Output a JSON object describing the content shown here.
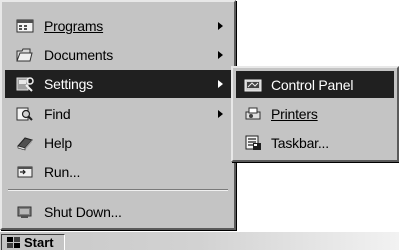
{
  "start_menu": {
    "items": [
      {
        "label": "Programs",
        "icon": "programs-icon",
        "has_submenu": true
      },
      {
        "label": "Documents",
        "icon": "documents-icon",
        "has_submenu": true
      },
      {
        "label": "Settings",
        "icon": "settings-icon",
        "has_submenu": true,
        "selected": true
      },
      {
        "label": "Find",
        "icon": "find-icon",
        "has_submenu": true
      },
      {
        "label": "Help",
        "icon": "help-icon",
        "has_submenu": false
      },
      {
        "label": "Run...",
        "icon": "run-icon",
        "has_submenu": false
      },
      {
        "label": "Shut Down...",
        "icon": "shut-down-icon",
        "has_submenu": false
      }
    ]
  },
  "settings_submenu": {
    "items": [
      {
        "label": "Control Panel",
        "icon": "control-panel-icon",
        "selected": true
      },
      {
        "label": "Printers",
        "icon": "printers-icon"
      },
      {
        "label": "Taskbar...",
        "icon": "taskbar-icon"
      }
    ]
  },
  "taskbar": {
    "start_label": "Start",
    "start_icon": "windows-logo-icon"
  },
  "colors": {
    "menu_background": "#c4c4c4",
    "selection": "#202020",
    "selection_text": "#ffffff"
  }
}
